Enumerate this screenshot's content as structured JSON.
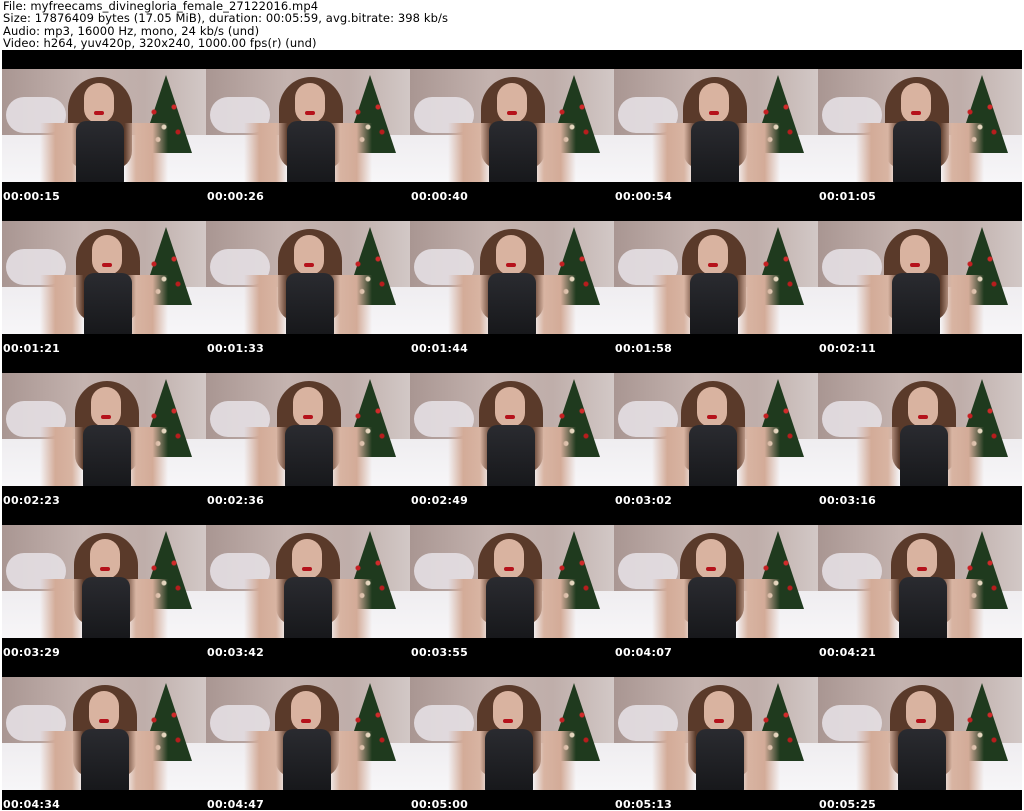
{
  "header": {
    "file": "File: myfreecams_divinegloria_female_27122016.mp4",
    "size": "Size: 17876409 bytes (17.05 MiB), duration: 00:05:59, avg.bitrate: 398 kb/s",
    "audio": "Audio: mp3, 16000 Hz, mono, 24 kb/s (und)",
    "video": "Video: h264, yuv420p, 320x240, 1000.00 fps(r) (und)"
  },
  "thumbnails": [
    {
      "timestamp": "00:00:15"
    },
    {
      "timestamp": "00:00:26"
    },
    {
      "timestamp": "00:00:40"
    },
    {
      "timestamp": "00:00:54"
    },
    {
      "timestamp": "00:01:05"
    },
    {
      "timestamp": "00:01:21"
    },
    {
      "timestamp": "00:01:33"
    },
    {
      "timestamp": "00:01:44"
    },
    {
      "timestamp": "00:01:58"
    },
    {
      "timestamp": "00:02:11"
    },
    {
      "timestamp": "00:02:23"
    },
    {
      "timestamp": "00:02:36"
    },
    {
      "timestamp": "00:02:49"
    },
    {
      "timestamp": "00:03:02"
    },
    {
      "timestamp": "00:03:16"
    },
    {
      "timestamp": "00:03:29"
    },
    {
      "timestamp": "00:03:42"
    },
    {
      "timestamp": "00:03:55"
    },
    {
      "timestamp": "00:04:07"
    },
    {
      "timestamp": "00:04:21"
    },
    {
      "timestamp": "00:04:34"
    },
    {
      "timestamp": "00:04:47"
    },
    {
      "timestamp": "00:05:00"
    },
    {
      "timestamp": "00:05:13"
    },
    {
      "timestamp": "00:05:25"
    }
  ]
}
